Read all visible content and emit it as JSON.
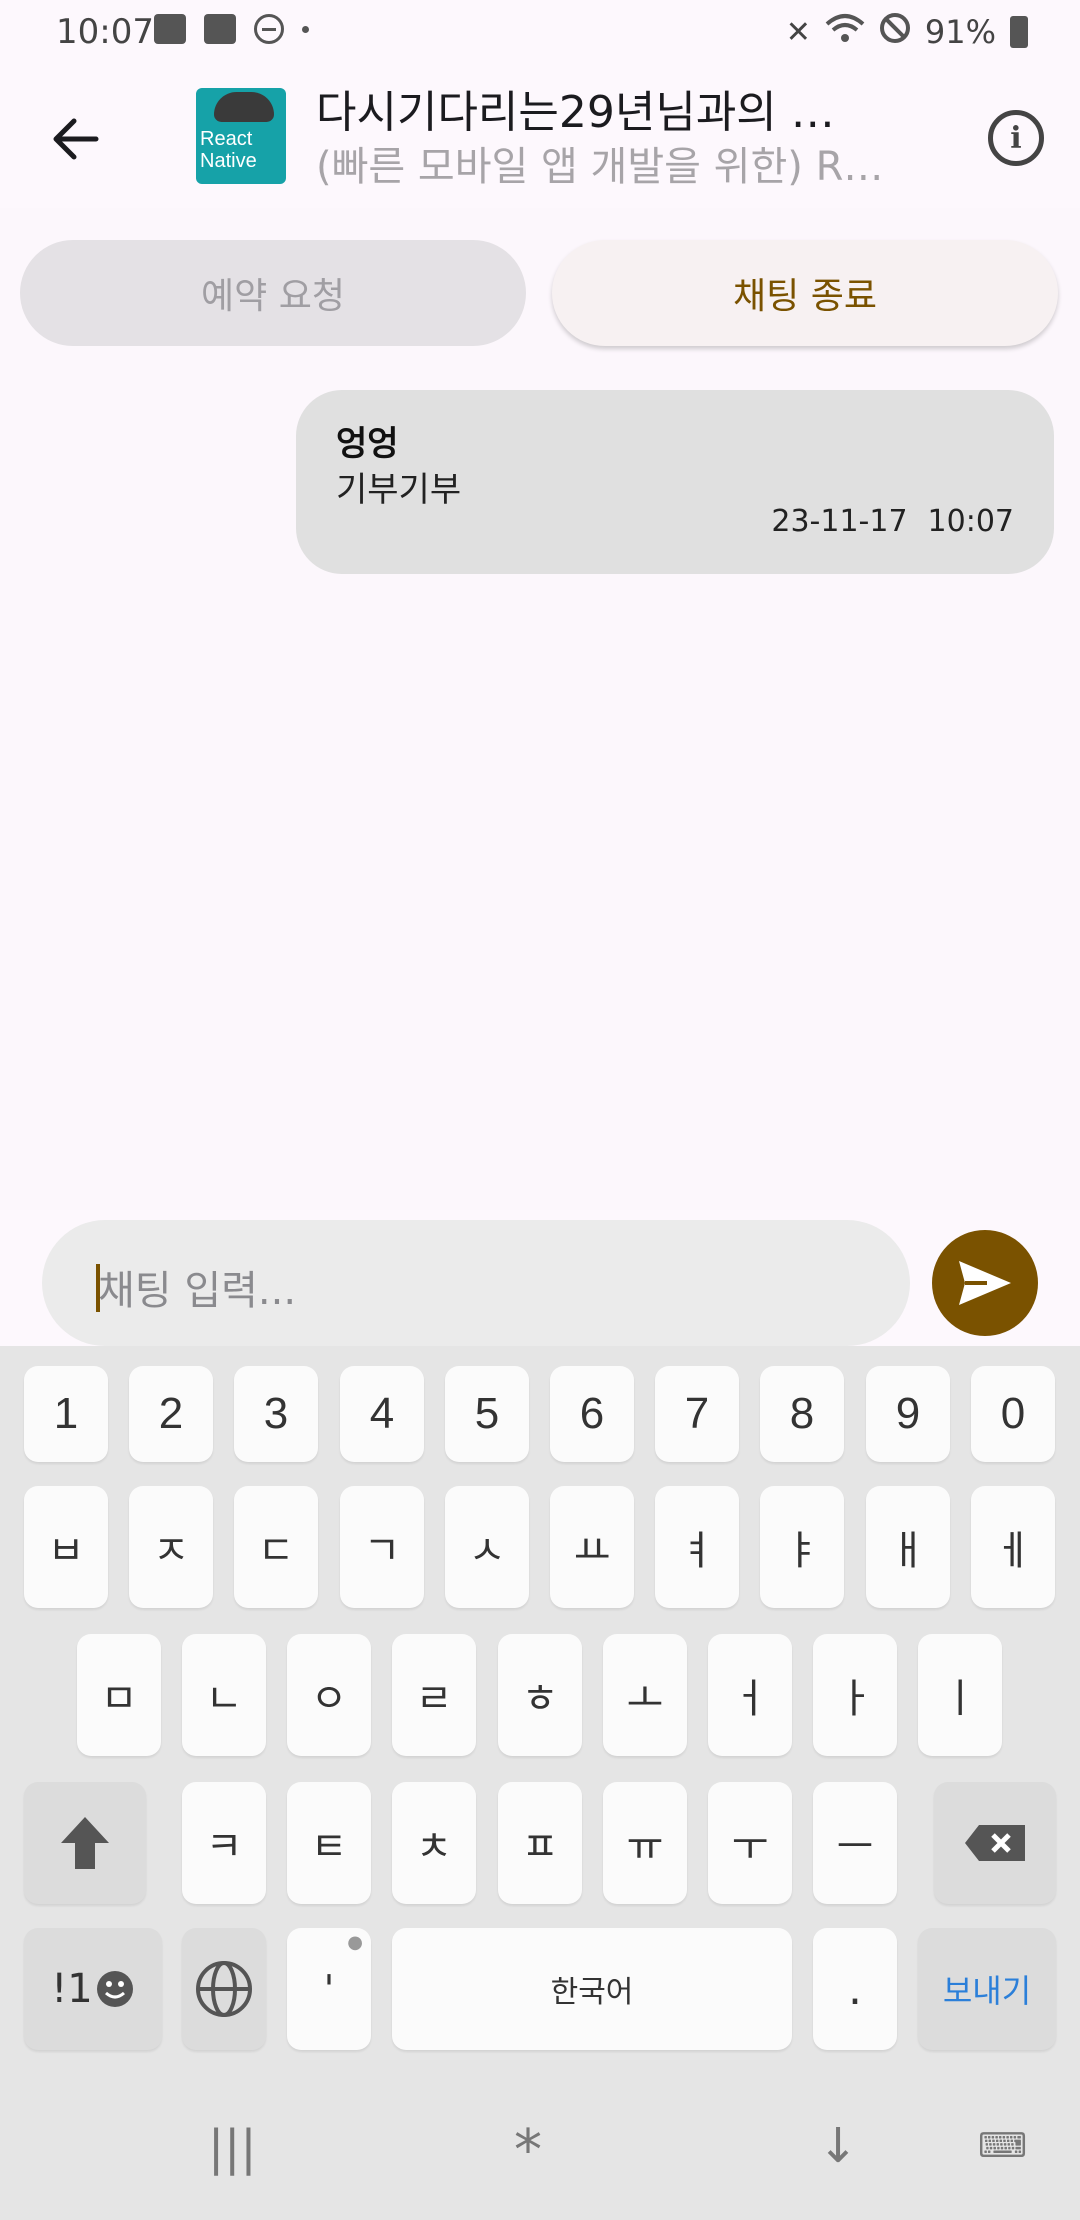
{
  "status_bar": {
    "time": "10:07",
    "battery": "91%"
  },
  "header": {
    "title": "다시기다리는29년님과의 …",
    "subtitle": "(빠른 모바일 앱 개발을 위한) R…",
    "thumb_line1": "React",
    "thumb_line2": "Native"
  },
  "actions": {
    "reserve_label": "예약 요청",
    "end_chat_label": "채팅 종료"
  },
  "messages": [
    {
      "sender": "엉엉",
      "text": "기부기부",
      "date": "23-11-17",
      "time": "10:07"
    }
  ],
  "input": {
    "placeholder": "채팅 입력..."
  },
  "keyboard": {
    "row_numbers": [
      "1",
      "2",
      "3",
      "4",
      "5",
      "6",
      "7",
      "8",
      "9",
      "0"
    ],
    "row1": [
      "ㅂ",
      "ㅈ",
      "ㄷ",
      "ㄱ",
      "ㅅ",
      "ㅛ",
      "ㅕ",
      "ㅑ",
      "ㅐ",
      "ㅔ"
    ],
    "row2": [
      "ㅁ",
      "ㄴ",
      "ㅇ",
      "ㄹ",
      "ㅎ",
      "ㅗ",
      "ㅓ",
      "ㅏ",
      "ㅣ"
    ],
    "row3": [
      "ㅋ",
      "ㅌ",
      "ㅊ",
      "ㅍ",
      "ㅠ",
      "ㅜ",
      "ㅡ"
    ],
    "symbols_label": "!1",
    "apostrophe": "'",
    "space_label": "한국어",
    "period": ".",
    "send_label": "보내기"
  },
  "colors": {
    "accent": "#7a5200",
    "bubble": "#e0e0e0",
    "background": "#fcf7fc"
  }
}
